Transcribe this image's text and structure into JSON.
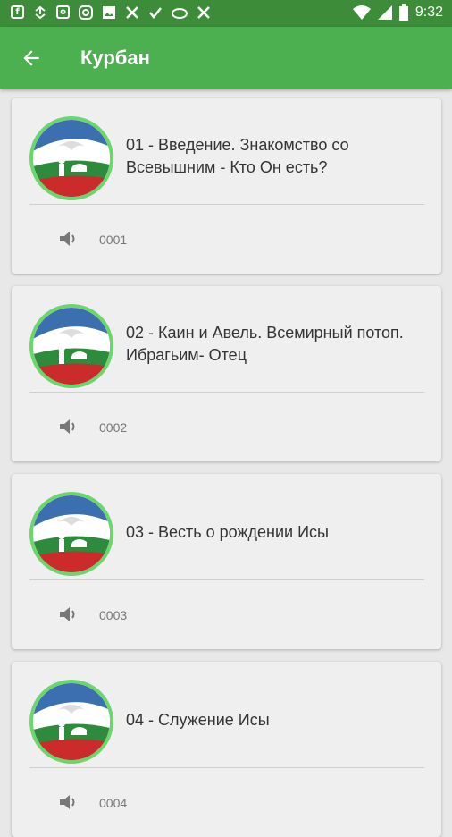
{
  "status_bar": {
    "time": "9:32",
    "notification_icons": [
      "facebook-icon",
      "sync-icon",
      "outlook-icon",
      "instagram-icon",
      "image-icon",
      "app-icon",
      "check-icon",
      "vpn-icon",
      "app-icon"
    ]
  },
  "app_bar": {
    "title": "Курбан",
    "color": "#4caf50"
  },
  "items": [
    {
      "title": "01 - Введение. Знакомство  со Всевышним - Кто Он есть?",
      "code": "0001"
    },
    {
      "title": "02 - Каин и Авель. Всемирный потоп. Ибрагьим- Отец",
      "code": "0002"
    },
    {
      "title": "03 - Весть о рождении Исы",
      "code": "0003"
    },
    {
      "title": "04 - Служение Исы",
      "code": "0004"
    }
  ]
}
